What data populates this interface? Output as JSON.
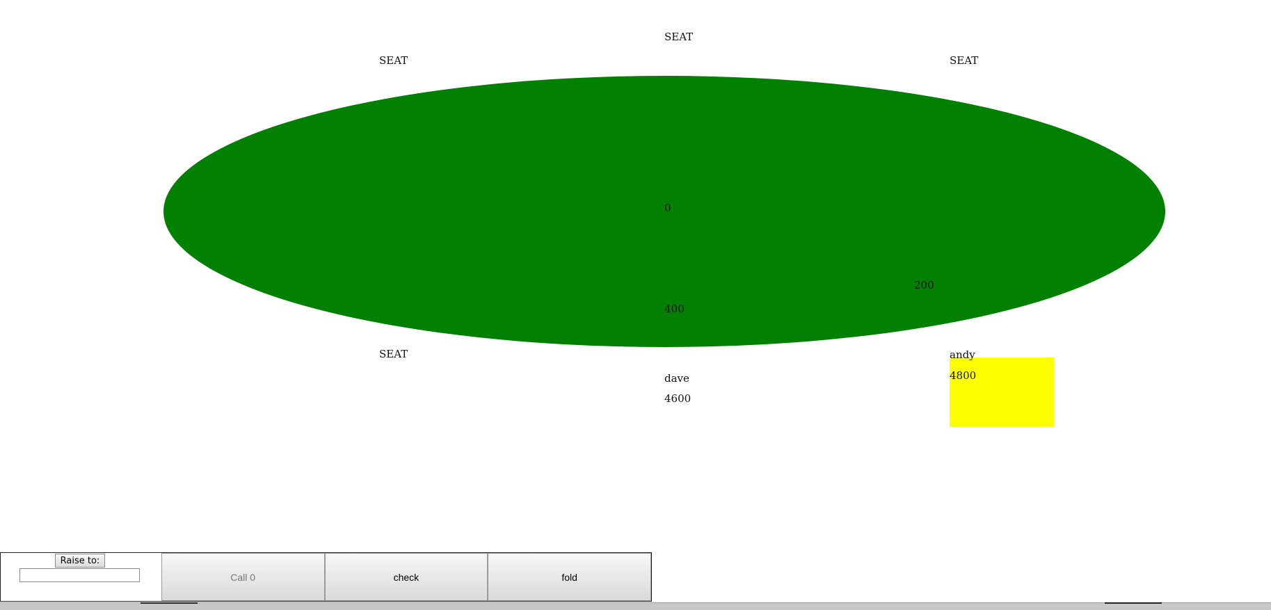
{
  "table": {
    "pot": "0"
  },
  "seats": {
    "top_center": {
      "label": "SEAT"
    },
    "top_left": {
      "label": "SEAT"
    },
    "top_right": {
      "label": "SEAT"
    },
    "bottom_left": {
      "label": "SEAT"
    },
    "bottom_center": {
      "name": "dave",
      "stack": "4600",
      "bet": "400"
    },
    "bottom_right": {
      "name": "andy",
      "stack": "4800",
      "bet": "200"
    }
  },
  "actions": {
    "raise_label": "Raise to:",
    "raise_value": "",
    "call_label": "Call 0",
    "check_label": "check",
    "fold_label": "fold"
  },
  "colors": {
    "felt": "#028002",
    "active_player": "#ffff00"
  }
}
